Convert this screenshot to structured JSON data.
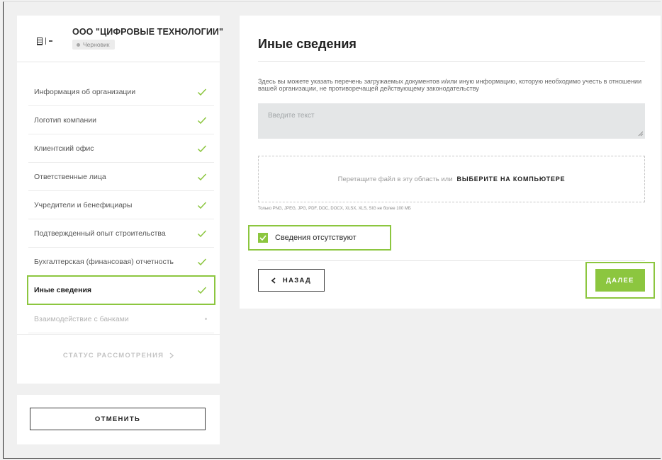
{
  "organization": {
    "name": "ООО \"ЦИФРОВЫЕ ТЕХНОЛОГИИ\"",
    "status_badge": "Черновик"
  },
  "sidebar": {
    "steps": [
      {
        "label": "Информация об организации",
        "state": "done"
      },
      {
        "label": "Логотип компании",
        "state": "done"
      },
      {
        "label": "Клиентский офис",
        "state": "done"
      },
      {
        "label": "Ответственные лица",
        "state": "done"
      },
      {
        "label": "Учредители и бенефициары",
        "state": "done"
      },
      {
        "label": "Подтвержденный опыт строительства",
        "state": "done"
      },
      {
        "label": "Бухгалтерская (финансовая) отчетность",
        "state": "done"
      },
      {
        "label": "Иные сведения",
        "state": "active"
      },
      {
        "label": "Взаимодействие с банками",
        "state": "disabled"
      }
    ],
    "status_link": "СТАТУС РАССМОТРЕНИЯ",
    "cancel_label": "ОТМЕНИТЬ"
  },
  "main": {
    "title": "Иные сведения",
    "description": "Здесь вы можете указать перечень загружаемых документов и/или иную информацию, которую необходимо учесть в отношении вашей организации, не противоречащей действующему законодательству",
    "textarea_placeholder": "Введите текст",
    "textarea_value": "",
    "dropzone_text": "Перетащите файл в эту область или",
    "dropzone_link": "ВЫБЕРИТЕ НА КОМПЬЮТЕРЕ",
    "file_hint": "Только PNG, JPEG, JPG, PDF, DOC, DOCX, XLSX, XLS, SIG не более 100 МБ",
    "absent_checkbox_label": "Сведения отсутствуют",
    "absent_checked": true,
    "back_label": "НАЗАД",
    "next_label": "ДАЛЕЕ"
  },
  "colors": {
    "accent": "#8cc63f",
    "background": "#f0f0f0",
    "field_bg": "#e4e6e7"
  },
  "icons": {
    "step_done": "check-icon",
    "step_pending": "dot-icon",
    "back": "chevron-left-icon",
    "status": "chevron-right-icon",
    "checkbox": "checkmark-icon"
  }
}
